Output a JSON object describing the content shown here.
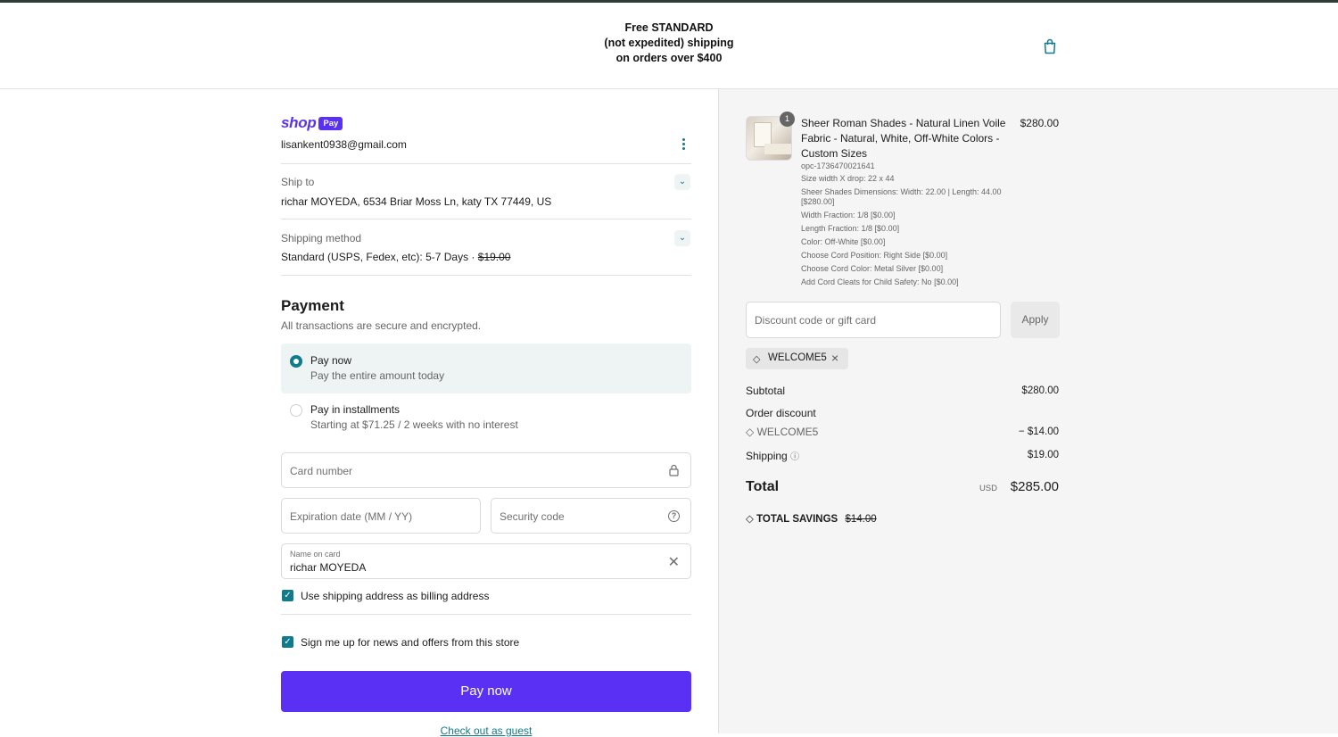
{
  "header": {
    "announcement": [
      "Free STANDARD",
      "(not expedited) shipping",
      "on orders over $400"
    ],
    "cart_icon": "shopping-bag-icon"
  },
  "account": {
    "shop_label": "shop",
    "pay_badge": "Pay",
    "email": "lisankent0938@gmail.com",
    "menu_icon": "more-vertical-icon"
  },
  "ship_to": {
    "label": "Ship to",
    "value": "richar MOYEDA, 6534 Briar Moss Ln, katy TX 77449, US"
  },
  "shipping_method": {
    "label": "Shipping method",
    "value": "Standard (USPS, Fedex, etc): 5-7 Days · ",
    "price": "$19.00"
  },
  "payment": {
    "title": "Payment",
    "subtitle": "All transactions are secure and encrypted.",
    "options": [
      {
        "title": "Pay now",
        "subtitle": "Pay the entire amount today",
        "selected": true
      },
      {
        "title": "Pay in installments",
        "subtitle": "Starting at $71.25 / 2 weeks with no interest",
        "selected": false
      }
    ],
    "card_number_placeholder": "Card number",
    "expiration_placeholder": "Expiration date (MM / YY)",
    "security_placeholder": "Security code",
    "name_label": "Name on card",
    "name_value": "richar MOYEDA",
    "billing_checkbox": "Use shipping address as billing address",
    "news_checkbox": "Sign me up for news and offers from this store",
    "pay_button": "Pay now",
    "guest_link": "Check out as guest"
  },
  "order": {
    "quantity": "1",
    "product_title": "Sheer Roman Shades - Natural Linen Voile Fabric - Natural, White, Off-White Colors - Custom Sizes",
    "product_price": "$280.00",
    "meta": [
      "opc-1736470021641",
      "Size width X drop: 22   x 44",
      "Sheer Shades Dimensions: Width: 22.00 | Length: 44.00 [$280.00]",
      "Width Fraction: 1/8   [$0.00]",
      "Length Fraction: 1/8   [$0.00]",
      "Color: Off-White [$0.00]",
      "Choose Cord Position: Right Side [$0.00]",
      "Choose Cord Color: Metal Silver [$0.00]",
      "Add Cord Cleats for Child Safety: No [$0.00]"
    ],
    "discount_placeholder": "Discount code or gift card",
    "apply_button": "Apply",
    "applied_code": "WELCOME5",
    "subtotal_label": "Subtotal",
    "subtotal_value": "$280.00",
    "order_discount_label": "Order discount",
    "discount_code": "WELCOME5",
    "discount_value": "− $14.00",
    "shipping_label": "Shipping",
    "shipping_value": "$19.00",
    "total_label": "Total",
    "currency": "USD",
    "total_value": "$285.00",
    "savings_label": "TOTAL SAVINGS",
    "savings_value": "$14.00"
  },
  "colors": {
    "accent": "#5a31f4",
    "teal": "#117a8b"
  }
}
